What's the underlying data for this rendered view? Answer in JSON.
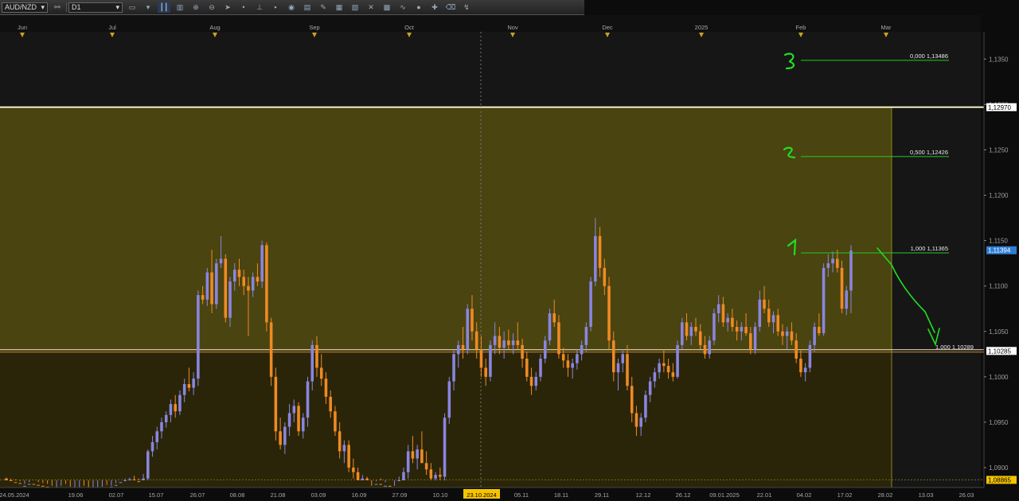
{
  "toolbar": {
    "symbol": "AUD/NZD",
    "timeframe": "D1",
    "icons": [
      "link-icon",
      "chart-type-icon",
      "crosshair-icon",
      "bar-style-icon",
      "zoom-in-icon",
      "zoom-out-icon",
      "cursor-icon",
      "dot-icon",
      "trendline-icon",
      "note-icon",
      "eye-icon",
      "indicator-icon",
      "template-icon",
      "shapes-icon",
      "grid-icon",
      "wave-icon",
      "circle-icon",
      "pin-icon",
      "eraser-icon",
      "signal-icon"
    ]
  },
  "chart_data": {
    "type": "candlestick",
    "symbol": "AUD/NZD",
    "timeframe": "D1",
    "ylim": [
      1.0886,
      1.138
    ],
    "month_labels": [
      "Jun",
      "Jul",
      "Aug",
      "Sep",
      "Oct",
      "Nov",
      "Dec",
      "2025",
      "Feb",
      "Mar"
    ],
    "date_labels": [
      "24.05.2024",
      "19.06",
      "02.07",
      "15.07",
      "26.07",
      "08.08",
      "21.08",
      "03.09",
      "16.09",
      "27.09",
      "10.10",
      "23.10.2024",
      "05.11",
      "18.11",
      "29.11",
      "12.12",
      "26.12",
      "09.01.2025",
      "22.01",
      "04.02",
      "17.02",
      "28.02",
      "13.03",
      "26.03"
    ],
    "price_ticks": [
      "1,1350",
      "1,1300",
      "1,1250",
      "1,1200",
      "1,1150",
      "1,1100",
      "1,1050",
      "1,1000",
      "1,0950",
      "1,0900"
    ],
    "price_tick_values": [
      1.135,
      1.13,
      1.125,
      1.12,
      1.115,
      1.11,
      1.105,
      1.1,
      1.095,
      1.09
    ],
    "price_tags": [
      {
        "label": "1,12970",
        "value": 1.1297,
        "style": "white"
      },
      {
        "label": "1,11394",
        "value": 1.11394,
        "style": "blue"
      },
      {
        "label": "1,10285",
        "value": 1.10285,
        "style": "white"
      },
      {
        "label": "1,08865",
        "value": 1.08865,
        "style": "yellow"
      }
    ],
    "zone": {
      "top": 1.1297,
      "bottom": 1.10285
    },
    "fib_levels": [
      {
        "label": "0,000 1,13486",
        "value": 1.13486,
        "annotation": "3"
      },
      {
        "label": "0,500 1,12426",
        "value": 1.12426,
        "annotation": "2"
      },
      {
        "label": "1,000 1,11365",
        "value": 1.11365,
        "annotation": "1"
      }
    ],
    "target_label": "1,000 1,10289",
    "target_value": 1.10289,
    "colors": {
      "up": "#8a86e0",
      "down": "#f08a24",
      "zone_fill": "#4a4410",
      "below_fill": "#2a2508",
      "fib": "#22cc22",
      "annotation": "#22dd22",
      "tag_blue": "#2e7ed6",
      "tag_yellow": "#f5c400"
    },
    "candles": [
      [
        1.0888,
        1.0889,
        1.0882,
        1.0886
      ],
      [
        1.0886,
        1.0888,
        1.088,
        1.0884
      ],
      [
        1.0884,
        1.0887,
        1.0878,
        1.0883
      ],
      [
        1.0883,
        1.0885,
        1.0875,
        1.0878
      ],
      [
        1.0878,
        1.0882,
        1.0874,
        1.088
      ],
      [
        1.088,
        1.0884,
        1.0876,
        1.0882
      ],
      [
        1.0882,
        1.0886,
        1.0879,
        1.0881
      ],
      [
        1.0881,
        1.0884,
        1.0878,
        1.088
      ],
      [
        1.088,
        1.0883,
        1.0876,
        1.0879
      ],
      [
        1.0879,
        1.0882,
        1.0875,
        1.0877
      ],
      [
        1.0877,
        1.088,
        1.0872,
        1.0874
      ],
      [
        1.0874,
        1.0878,
        1.087,
        1.0876
      ],
      [
        1.0876,
        1.088,
        1.0872,
        1.0878
      ],
      [
        1.0878,
        1.0882,
        1.0873,
        1.0875
      ],
      [
        1.0875,
        1.0879,
        1.087,
        1.0872
      ],
      [
        1.0872,
        1.0876,
        1.0868,
        1.0874
      ],
      [
        1.0874,
        1.0878,
        1.087,
        1.0877
      ],
      [
        1.0877,
        1.088,
        1.0872,
        1.0873
      ],
      [
        1.0873,
        1.0877,
        1.0868,
        1.087
      ],
      [
        1.087,
        1.0874,
        1.0866,
        1.0872
      ],
      [
        1.0872,
        1.0876,
        1.0869,
        1.0875
      ],
      [
        1.0875,
        1.0879,
        1.0871,
        1.0878
      ],
      [
        1.0878,
        1.0881,
        1.0874,
        1.0876
      ],
      [
        1.0876,
        1.088,
        1.0872,
        1.0879
      ],
      [
        1.0879,
        1.0883,
        1.0876,
        1.0881
      ],
      [
        1.0881,
        1.0886,
        1.0878,
        1.0884
      ],
      [
        1.0884,
        1.0888,
        1.088,
        1.0886
      ],
      [
        1.0886,
        1.0889,
        1.0882,
        1.0887
      ],
      [
        1.0887,
        1.0891,
        1.0883,
        1.0885
      ],
      [
        1.0885,
        1.0888,
        1.088,
        1.0883
      ],
      [
        1.0883,
        1.0893,
        1.0881,
        1.0888
      ],
      [
        1.0888,
        1.092,
        1.0885,
        1.0918
      ],
      [
        1.0918,
        1.0935,
        1.0912,
        1.0928
      ],
      [
        1.0928,
        1.0945,
        1.092,
        1.094
      ],
      [
        1.094,
        1.0955,
        1.0932,
        1.095
      ],
      [
        1.095,
        1.0962,
        1.0944,
        1.0958
      ],
      [
        1.0958,
        1.0975,
        1.095,
        1.097
      ],
      [
        1.097,
        1.098,
        1.0955,
        1.0962
      ],
      [
        1.0962,
        1.0985,
        1.0958,
        1.098
      ],
      [
        1.098,
        1.0998,
        1.0972,
        1.0992
      ],
      [
        1.0992,
        1.101,
        1.0984,
        1.0988
      ],
      [
        1.0988,
        1.1005,
        1.098,
        1.0998
      ],
      [
        1.0998,
        1.1095,
        1.099,
        1.109
      ],
      [
        1.109,
        1.11,
        1.108,
        1.1085
      ],
      [
        1.1085,
        1.112,
        1.1078,
        1.1115
      ],
      [
        1.1115,
        1.114,
        1.107,
        1.108
      ],
      [
        1.108,
        1.113,
        1.1075,
        1.1125
      ],
      [
        1.1125,
        1.1155,
        1.112,
        1.113
      ],
      [
        1.113,
        1.1135,
        1.106,
        1.1065
      ],
      [
        1.1065,
        1.111,
        1.1055,
        1.1105
      ],
      [
        1.1105,
        1.1125,
        1.1095,
        1.1118
      ],
      [
        1.1118,
        1.113,
        1.11,
        1.111
      ],
      [
        1.111,
        1.1118,
        1.109,
        1.11
      ],
      [
        1.11,
        1.111,
        1.1045,
        1.1095
      ],
      [
        1.1095,
        1.1115,
        1.1088,
        1.111
      ],
      [
        1.111,
        1.1125,
        1.11,
        1.1105
      ],
      [
        1.1105,
        1.115,
        1.1098,
        1.1145
      ],
      [
        1.1145,
        1.1148,
        1.105,
        1.106
      ],
      [
        1.106,
        1.1065,
        1.099,
        1.1
      ],
      [
        1.1,
        1.101,
        1.093,
        1.094
      ],
      [
        1.094,
        1.0955,
        1.092,
        1.0925
      ],
      [
        1.0925,
        1.095,
        1.0915,
        1.0945
      ],
      [
        1.0945,
        1.097,
        1.0935,
        1.096
      ],
      [
        1.096,
        1.0975,
        1.095,
        1.0968
      ],
      [
        1.0968,
        1.0972,
        1.0935,
        1.094
      ],
      [
        1.094,
        1.096,
        1.0932,
        1.0955
      ],
      [
        1.0955,
        1.1,
        1.0945,
        1.0995
      ],
      [
        1.0995,
        1.104,
        1.0985,
        1.1035
      ],
      [
        1.1035,
        1.1045,
        1.1,
        1.101
      ],
      [
        1.101,
        1.1025,
        1.099,
        1.0998
      ],
      [
        1.0998,
        1.1005,
        1.097,
        1.0978
      ],
      [
        1.0978,
        1.0985,
        1.0955,
        1.0962
      ],
      [
        1.0962,
        1.0968,
        1.0935,
        1.094
      ],
      [
        1.094,
        1.095,
        1.091,
        1.0918
      ],
      [
        1.0918,
        1.093,
        1.0905,
        1.0925
      ],
      [
        1.0925,
        1.093,
        1.0895,
        1.09
      ],
      [
        1.09,
        1.091,
        1.0888,
        1.0895
      ],
      [
        1.0895,
        1.09,
        1.0875,
        1.088
      ],
      [
        1.088,
        1.0892,
        1.0872,
        1.0888
      ],
      [
        1.0888,
        1.089,
        1.087,
        1.0876
      ],
      [
        1.0876,
        1.088,
        1.0865,
        1.087
      ],
      [
        1.087,
        1.0885,
        1.0866,
        1.0882
      ],
      [
        1.0882,
        1.0888,
        1.0874,
        1.0878
      ],
      [
        1.0878,
        1.0884,
        1.087,
        1.088
      ],
      [
        1.088,
        1.0886,
        1.0872,
        1.0875
      ],
      [
        1.0875,
        1.088,
        1.0868,
        1.0878
      ],
      [
        1.0878,
        1.089,
        1.0874,
        1.0886
      ],
      [
        1.0886,
        1.09,
        1.088,
        1.0895
      ],
      [
        1.0895,
        1.0925,
        1.0888,
        1.0918
      ],
      [
        1.0918,
        1.0935,
        1.0905,
        1.091
      ],
      [
        1.091,
        1.0925,
        1.0898,
        1.092
      ],
      [
        1.092,
        1.094,
        1.0912,
        1.0905
      ],
      [
        1.0905,
        1.0918,
        1.0892,
        1.0898
      ],
      [
        1.0898,
        1.0905,
        1.0884,
        1.0888
      ],
      [
        1.0888,
        1.0895,
        1.088,
        1.0892
      ],
      [
        1.0892,
        1.09,
        1.0885,
        1.089
      ],
      [
        1.089,
        1.096,
        1.0886,
        1.0955
      ],
      [
        1.0955,
        1.1,
        1.0948,
        1.0995
      ],
      [
        1.0995,
        1.103,
        1.0985,
        1.1025
      ],
      [
        1.1025,
        1.104,
        1.101,
        1.1035
      ],
      [
        1.1035,
        1.1055,
        1.102,
        1.103
      ],
      [
        1.103,
        1.108,
        1.1025,
        1.1075
      ],
      [
        1.1075,
        1.109,
        1.104,
        1.105
      ],
      [
        1.105,
        1.106,
        1.102,
        1.103
      ],
      [
        1.103,
        1.1045,
        1.1,
        1.101
      ],
      [
        1.101,
        1.102,
        1.099,
        1.1
      ],
      [
        1.1,
        1.104,
        1.0995,
        1.1035
      ],
      [
        1.1035,
        1.106,
        1.1025,
        1.1045
      ],
      [
        1.1045,
        1.1055,
        1.1025,
        1.1032
      ],
      [
        1.1032,
        1.105,
        1.102,
        1.104
      ],
      [
        1.104,
        1.1052,
        1.103,
        1.1035
      ],
      [
        1.1035,
        1.1048,
        1.1025,
        1.104
      ],
      [
        1.104,
        1.106,
        1.103,
        1.1035
      ],
      [
        1.1035,
        1.1042,
        1.101,
        1.102
      ],
      [
        1.102,
        1.1028,
        1.0995,
        1.1
      ],
      [
        1.1,
        1.101,
        1.098,
        1.099
      ],
      [
        1.099,
        1.1005,
        1.0985,
        1.1
      ],
      [
        1.1,
        1.1025,
        1.0995,
        1.102
      ],
      [
        1.102,
        1.1045,
        1.1015,
        1.104
      ],
      [
        1.104,
        1.1075,
        1.1035,
        1.107
      ],
      [
        1.107,
        1.1085,
        1.1055,
        1.106
      ],
      [
        1.106,
        1.1068,
        1.102,
        1.1025
      ],
      [
        1.1025,
        1.1032,
        1.101,
        1.1018
      ],
      [
        1.1018,
        1.1025,
        1.1,
        1.101
      ],
      [
        1.101,
        1.102,
        1.0998,
        1.1015
      ],
      [
        1.1015,
        1.103,
        1.1008,
        1.1025
      ],
      [
        1.1025,
        1.104,
        1.1018,
        1.1035
      ],
      [
        1.1035,
        1.106,
        1.1028,
        1.1055
      ],
      [
        1.1055,
        1.111,
        1.105,
        1.1105
      ],
      [
        1.1105,
        1.1175,
        1.11,
        1.1155
      ],
      [
        1.1155,
        1.1165,
        1.111,
        1.112
      ],
      [
        1.112,
        1.113,
        1.109,
        1.11
      ],
      [
        1.11,
        1.111,
        1.103,
        1.104
      ],
      [
        1.104,
        1.105,
        1.0995,
        1.1005
      ],
      [
        1.1005,
        1.102,
        1.0985,
        1.1015
      ],
      [
        1.1015,
        1.103,
        1.1005,
        1.1025
      ],
      [
        1.1025,
        1.1035,
        1.0985,
        1.099
      ],
      [
        1.099,
        1.1,
        1.095,
        1.096
      ],
      [
        1.096,
        1.0968,
        1.0935,
        1.0945
      ],
      [
        1.0945,
        1.096,
        1.0935,
        1.0955
      ],
      [
        1.0955,
        1.0985,
        1.095,
        1.098
      ],
      [
        1.098,
        1.1,
        1.0972,
        1.0995
      ],
      [
        1.0995,
        1.101,
        1.0988,
        1.1005
      ],
      [
        1.1005,
        1.102,
        1.0998,
        1.1015
      ],
      [
        1.1015,
        1.103,
        1.1005,
        1.1012
      ],
      [
        1.1012,
        1.102,
        1.0998,
        1.1005
      ],
      [
        1.1005,
        1.1015,
        1.0995,
        1.1
      ],
      [
        1.1,
        1.104,
        1.0998,
        1.1035
      ],
      [
        1.1035,
        1.1065,
        1.103,
        1.106
      ],
      [
        1.106,
        1.107,
        1.104,
        1.1045
      ],
      [
        1.1045,
        1.106,
        1.1035,
        1.1055
      ],
      [
        1.1055,
        1.1065,
        1.1045,
        1.105
      ],
      [
        1.105,
        1.1058,
        1.103,
        1.1035
      ],
      [
        1.1035,
        1.1045,
        1.102,
        1.1025
      ],
      [
        1.1025,
        1.1045,
        1.102,
        1.104
      ],
      [
        1.104,
        1.1075,
        1.1035,
        1.107
      ],
      [
        1.107,
        1.109,
        1.106,
        1.108
      ],
      [
        1.108,
        1.1088,
        1.1055,
        1.106
      ],
      [
        1.106,
        1.107,
        1.105,
        1.1065
      ],
      [
        1.1065,
        1.1075,
        1.105,
        1.1055
      ],
      [
        1.1055,
        1.1062,
        1.104,
        1.105
      ],
      [
        1.105,
        1.106,
        1.104,
        1.1055
      ],
      [
        1.1055,
        1.107,
        1.1045,
        1.1048
      ],
      [
        1.1048,
        1.1055,
        1.1025,
        1.103
      ],
      [
        1.103,
        1.106,
        1.1025,
        1.1055
      ],
      [
        1.1055,
        1.1095,
        1.105,
        1.1085
      ],
      [
        1.1085,
        1.11,
        1.107,
        1.1075
      ],
      [
        1.1075,
        1.1085,
        1.1055,
        1.106
      ],
      [
        1.106,
        1.1072,
        1.1048,
        1.1068
      ],
      [
        1.1068,
        1.1075,
        1.1045,
        1.105
      ],
      [
        1.105,
        1.1058,
        1.1035,
        1.1045
      ],
      [
        1.1045,
        1.1055,
        1.103,
        1.105
      ],
      [
        1.105,
        1.106,
        1.1035,
        1.104
      ],
      [
        1.104,
        1.1048,
        1.1015,
        1.102
      ],
      [
        1.102,
        1.103,
        1.1,
        1.1005
      ],
      [
        1.1005,
        1.1015,
        1.0995,
        1.101
      ],
      [
        1.101,
        1.104,
        1.1005,
        1.1035
      ],
      [
        1.1035,
        1.106,
        1.1028,
        1.1055
      ],
      [
        1.1055,
        1.107,
        1.1045,
        1.1048
      ],
      [
        1.1048,
        1.1125,
        1.1045,
        1.112
      ],
      [
        1.112,
        1.1135,
        1.111,
        1.1125
      ],
      [
        1.1125,
        1.1138,
        1.1115,
        1.113
      ],
      [
        1.113,
        1.114,
        1.1115,
        1.112
      ],
      [
        1.112,
        1.1128,
        1.107,
        1.1075
      ],
      [
        1.1075,
        1.11,
        1.1068,
        1.1095
      ],
      [
        1.1095,
        1.1145,
        1.107,
        1.1139
      ]
    ]
  }
}
